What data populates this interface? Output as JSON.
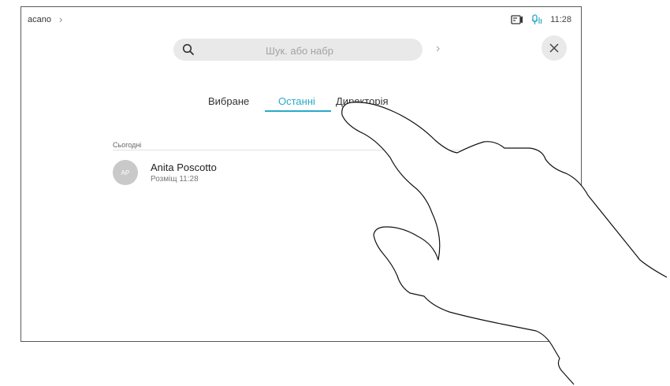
{
  "device": {
    "name": "acano",
    "chevron": "›"
  },
  "status": {
    "time": "11:28",
    "icons": [
      "screen-share-icon",
      "mic-active-icon"
    ]
  },
  "search": {
    "placeholder": "Шук. або набр",
    "go_chevron": "›"
  },
  "close_icon": "close-icon",
  "tabs": [
    {
      "label": "Вибране",
      "active": false
    },
    {
      "label": "Останні",
      "active": true
    },
    {
      "label": "Директорія",
      "active": false
    }
  ],
  "recents": {
    "section_label": "Сьогодні",
    "items": [
      {
        "initials": "AP",
        "name": "Anita Poscotto",
        "detail": "Розміщ 11:28"
      }
    ]
  },
  "colors": {
    "accent": "#2aa9c9",
    "mic": "#2aa9c9",
    "avatar": "#c9c9c9"
  }
}
